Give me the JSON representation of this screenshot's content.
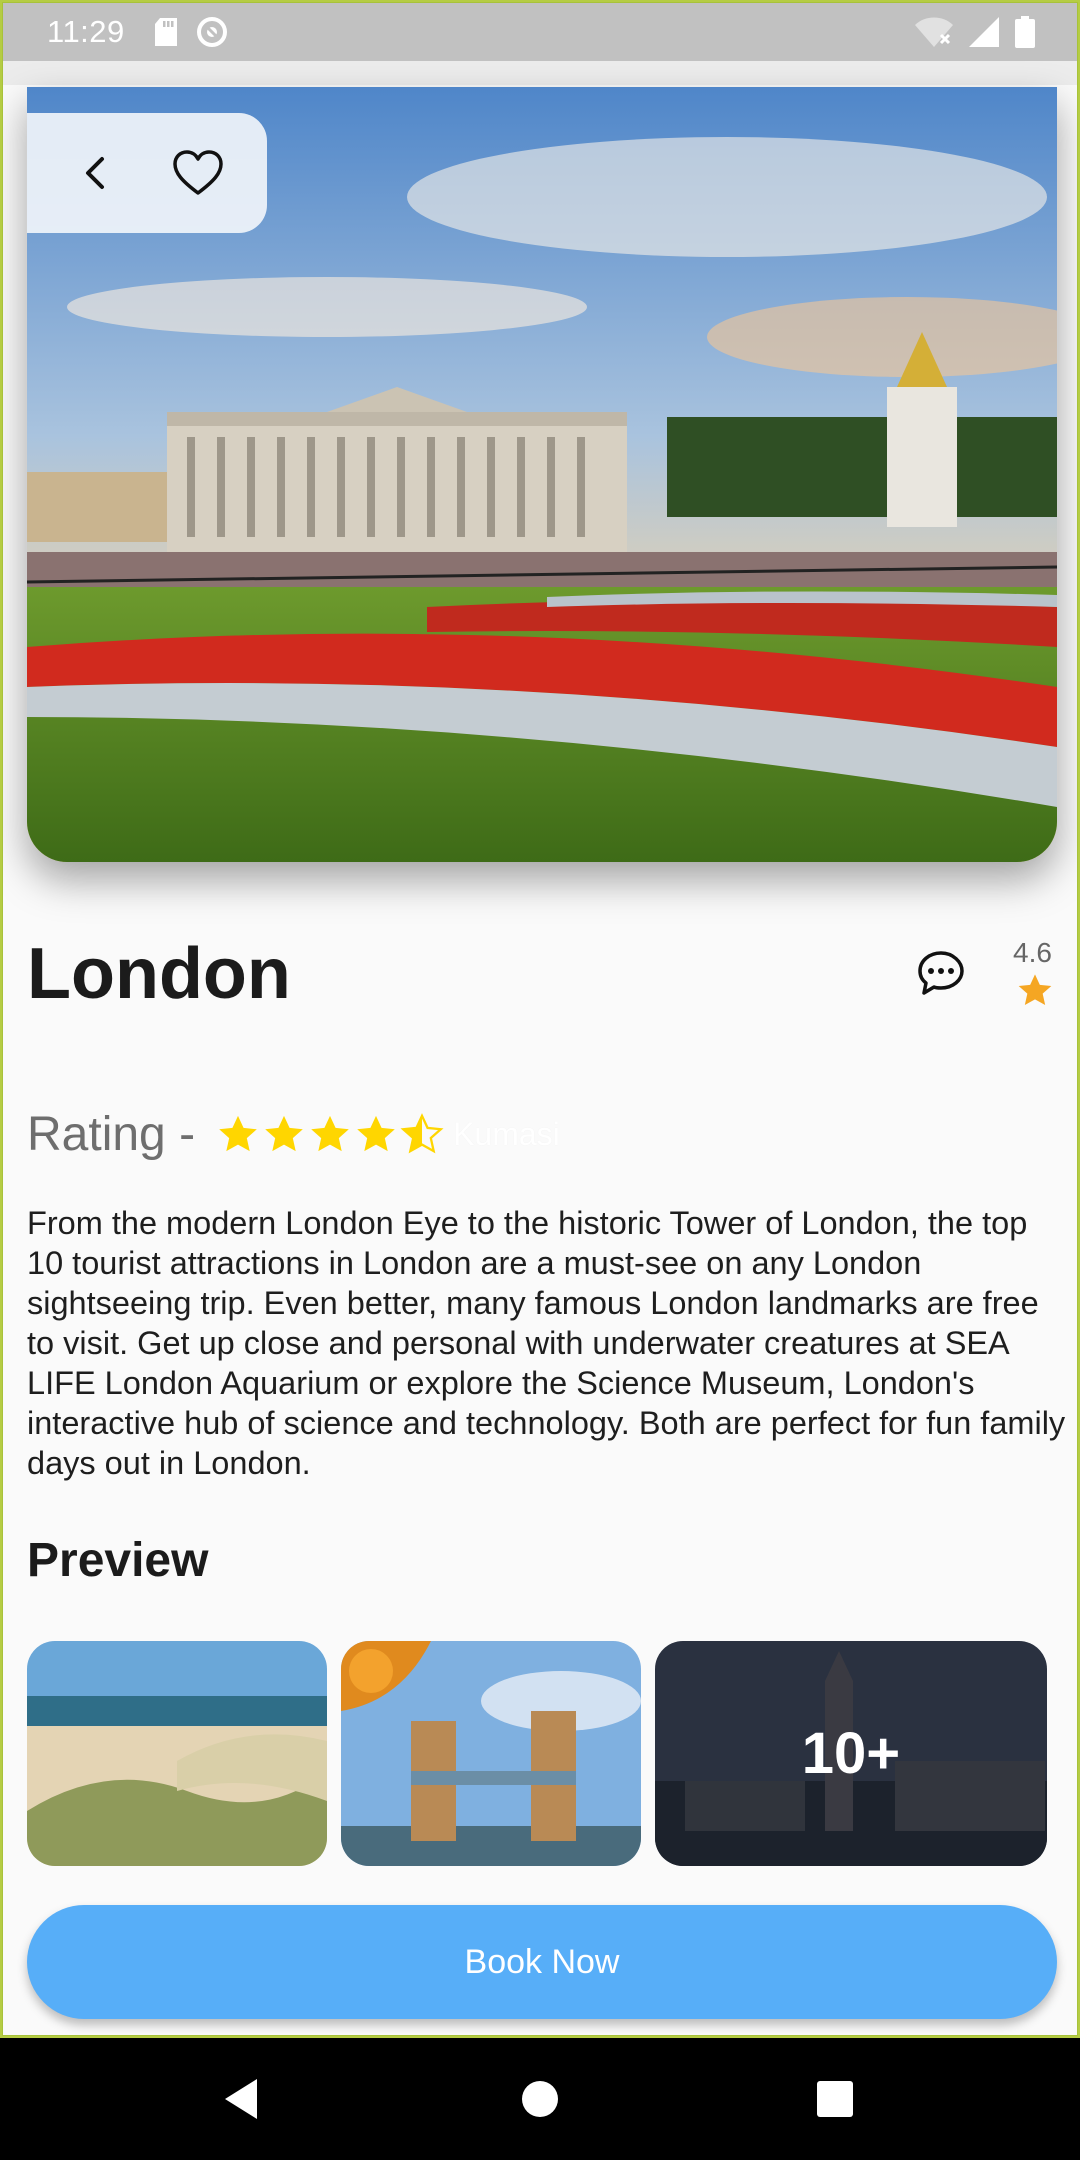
{
  "status_bar": {
    "time": "11:29",
    "icons_left": [
      "sd-card-icon",
      "data-saver-icon"
    ],
    "icons_right": [
      "wifi-off-icon",
      "signal-icon",
      "battery-icon"
    ]
  },
  "hero": {
    "image": "buckingham-palace-photo",
    "back_icon": "chevron-left-icon",
    "favorite_icon": "heart-outline-icon"
  },
  "place": {
    "title": "London",
    "rating_value": "4.6",
    "chat_icon": "chat-bubble-icon"
  },
  "rating_row": {
    "label": "Rating -",
    "stars": 4.5,
    "location": "Kumasi"
  },
  "description": "From the modern London Eye to the historic Tower of London, the top 10 tourist attractions in London are a must-see on any London sightseeing trip. Even better, many famous London landmarks are free to visit. Get up close and personal with underwater creatures at SEA LIFE London Aquarium or explore the Science Museum, London's interactive hub of science and technology. Both are perfect for fun family days out in London.",
  "preview": {
    "title": "Preview",
    "items": [
      {
        "image": "beach-dunes-photo"
      },
      {
        "image": "tower-bridge-photo"
      },
      {
        "image": "big-ben-night-photo",
        "overlay_label": "10+"
      }
    ]
  },
  "cta": {
    "label": "Book Now"
  },
  "colors": {
    "accent": "#57aef8",
    "star": "#f5a623",
    "rating_star": "#ffd600"
  }
}
